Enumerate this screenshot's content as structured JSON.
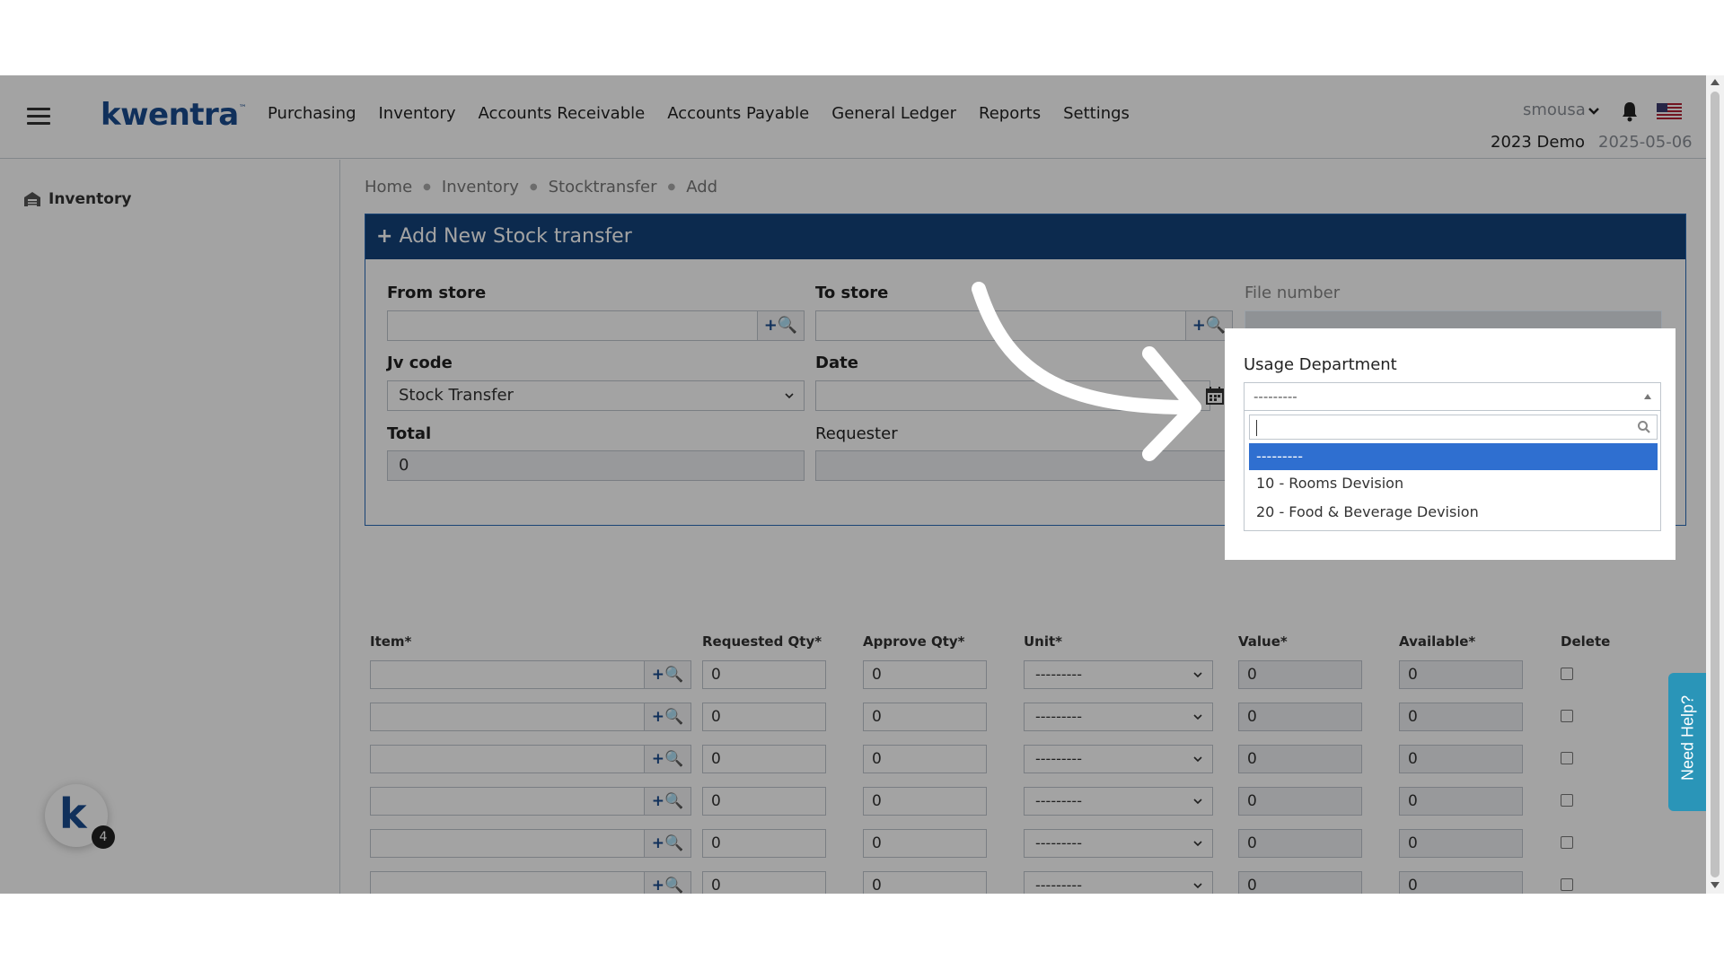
{
  "brand": {
    "logo_text": "kwentra",
    "logo_mark": "™"
  },
  "nav": {
    "menu": [
      "Purchasing",
      "Inventory",
      "Accounts Receivable",
      "Accounts Payable",
      "General Ledger",
      "Reports",
      "Settings"
    ],
    "user": "smousa",
    "company": "2023 Demo",
    "date": "2025-05-06"
  },
  "sidebar": {
    "item": "Inventory",
    "badge_count": "4"
  },
  "breadcrumb": [
    "Home",
    "Inventory",
    "Stocktransfer",
    "Add"
  ],
  "form": {
    "title": "Add New Stock transfer",
    "title_icon": "+",
    "from_store_label": "From store",
    "to_store_label": "To store",
    "file_number_label": "File number",
    "jv_code_label": "Jv code",
    "jv_code_value": "Stock Transfer",
    "date_label": "Date",
    "total_label": "Total",
    "total_value": "0",
    "requester_label": "Requester",
    "usage_department_label": "Usage Department",
    "usage_department_value": "---------",
    "usage_department_options": [
      "---------",
      "10 - Rooms Devision",
      "20 - Food & Beverage Devision"
    ],
    "lookup_addon": "+🔍"
  },
  "table": {
    "headers": [
      "Item*",
      "Requested Qty*",
      "Approve Qty*",
      "Unit*",
      "Value*",
      "Available*",
      "Delete"
    ],
    "row_defaults": {
      "requested": "0",
      "approve": "0",
      "unit": "---------",
      "value": "0",
      "available": "0"
    },
    "row_count": 8
  },
  "help_tab": "Need Help?",
  "colors": {
    "header_blue": "#14427a",
    "accent_blue": "#2f6fd0",
    "help_teal": "#2a95b8",
    "logo_blue": "#1a4c8f"
  },
  "icons": [
    "hamburger-icon",
    "chevron-down-icon",
    "bell-icon",
    "us-flag-icon",
    "warehouse-icon",
    "plus-search-icon",
    "calendar-icon",
    "search-icon",
    "arrow-annotation-icon"
  ]
}
